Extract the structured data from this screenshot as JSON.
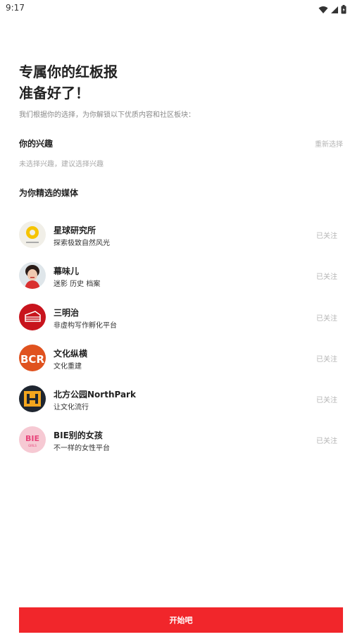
{
  "status_bar": {
    "time": "9:17",
    "icons": [
      "wifi-icon",
      "signal-icon",
      "battery-icon"
    ]
  },
  "header": {
    "title_line1": "专属你的红板报",
    "title_line2": "准备好了！",
    "subtitle": "我们根据你的选择，为你解锁以下优质内容和社区板块："
  },
  "interests": {
    "title": "你的兴趣",
    "reselect_label": "重新选择",
    "empty_text": "未选择兴趣，建议选择兴趣"
  },
  "media": {
    "title": "为你精选的媒体",
    "items": [
      {
        "name": "星球研究所",
        "desc": "探索极致自然风光",
        "status": "已关注",
        "avatar": "planet-institute-logo"
      },
      {
        "name": "幕味儿",
        "desc": "迷影 历史 档案",
        "status": "已关注",
        "avatar": "muwei-portrait"
      },
      {
        "name": "三明治",
        "desc": "非虚构写作孵化平台",
        "status": "已关注",
        "avatar": "sandwich-logo"
      },
      {
        "name": "文化纵横",
        "desc": "文化重建",
        "status": "已关注",
        "avatar": "bcr-logo"
      },
      {
        "name": "北方公园NorthPark",
        "desc": "让文化流行",
        "status": "已关注",
        "avatar": "northpark-logo"
      },
      {
        "name": "BIE别的女孩",
        "desc": "不一样的女性平台",
        "status": "已关注",
        "avatar": "bie-girls-logo"
      }
    ]
  },
  "footer": {
    "start_label": "开始吧"
  },
  "colors": {
    "accent": "#f1262b",
    "muted": "#b5b5b5"
  }
}
